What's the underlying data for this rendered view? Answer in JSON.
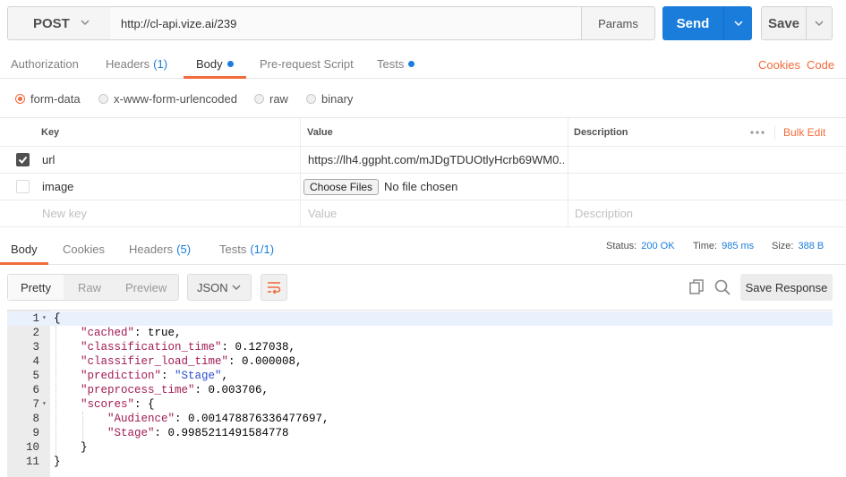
{
  "request": {
    "method": "POST",
    "url": "http://cl-api.vize.ai/239",
    "params_label": "Params",
    "send_label": "Send",
    "save_label": "Save"
  },
  "request_tabs": [
    {
      "label": "Authorization"
    },
    {
      "label": "Headers",
      "count": "(1)"
    },
    {
      "label": "Body"
    },
    {
      "label": "Pre-request Script"
    },
    {
      "label": "Tests"
    }
  ],
  "links": {
    "cookies": "Cookies",
    "code": "Code"
  },
  "body_types": [
    "form-data",
    "x-www-form-urlencoded",
    "raw",
    "binary"
  ],
  "body_type_selected": "form-data",
  "kv_table": {
    "headers": {
      "key": "Key",
      "value": "Value",
      "description": "Description"
    },
    "bulk_edit": "Bulk Edit",
    "rows": [
      {
        "checked": true,
        "key": "url",
        "value": "https://lh4.ggpht.com/mJDgTDUOtlyHcrb69WM0..."
      },
      {
        "checked": false,
        "key": "image",
        "file_button": "Choose Files",
        "file_status": "No file chosen"
      }
    ],
    "placeholders": {
      "key": "New key",
      "value": "Value",
      "description": "Description"
    }
  },
  "response_tabs": [
    {
      "label": "Body"
    },
    {
      "label": "Cookies"
    },
    {
      "label": "Headers",
      "count": "(5)"
    },
    {
      "label": "Tests",
      "count": "(1/1)"
    }
  ],
  "response_meta": {
    "status_label": "Status:",
    "status": "200 OK",
    "time_label": "Time:",
    "time": "985 ms",
    "size_label": "Size:",
    "size": "388 B"
  },
  "response_toolbar": {
    "views": [
      "Pretty",
      "Raw",
      "Preview"
    ],
    "active_view": "Pretty",
    "format": "JSON",
    "save_response": "Save Response"
  },
  "colors": {
    "accent": "#f26b3a",
    "primary": "#1a7ddc"
  },
  "code_lines": [
    {
      "n": "1",
      "fold": true,
      "indent": 0,
      "parts": [
        [
          "p",
          "{"
        ]
      ]
    },
    {
      "n": "2",
      "indent": 1,
      "parts": [
        [
          "k",
          "\"cached\""
        ],
        [
          "p",
          ": true,"
        ]
      ]
    },
    {
      "n": "3",
      "indent": 1,
      "parts": [
        [
          "k",
          "\"classification_time\""
        ],
        [
          "p",
          ": 0.127038,"
        ]
      ]
    },
    {
      "n": "4",
      "indent": 1,
      "parts": [
        [
          "k",
          "\"classifier_load_time\""
        ],
        [
          "p",
          ": 0.000008,"
        ]
      ]
    },
    {
      "n": "5",
      "indent": 1,
      "parts": [
        [
          "k",
          "\"prediction\""
        ],
        [
          "p",
          ": "
        ],
        [
          "s",
          "\"Stage\""
        ],
        [
          "p",
          ","
        ]
      ]
    },
    {
      "n": "6",
      "indent": 1,
      "parts": [
        [
          "k",
          "\"preprocess_time\""
        ],
        [
          "p",
          ": 0.003706,"
        ]
      ]
    },
    {
      "n": "7",
      "fold": true,
      "indent": 1,
      "parts": [
        [
          "k",
          "\"scores\""
        ],
        [
          "p",
          ": {"
        ]
      ]
    },
    {
      "n": "8",
      "indent": 2,
      "parts": [
        [
          "k",
          "\"Audience\""
        ],
        [
          "p",
          ": 0.001478876336477697,"
        ]
      ]
    },
    {
      "n": "9",
      "indent": 2,
      "parts": [
        [
          "k",
          "\"Stage\""
        ],
        [
          "p",
          ": 0.9985211491584778"
        ]
      ]
    },
    {
      "n": "10",
      "indent": 1,
      "parts": [
        [
          "p",
          "}"
        ]
      ]
    },
    {
      "n": "11",
      "indent": 0,
      "parts": [
        [
          "p",
          "}"
        ]
      ]
    }
  ]
}
